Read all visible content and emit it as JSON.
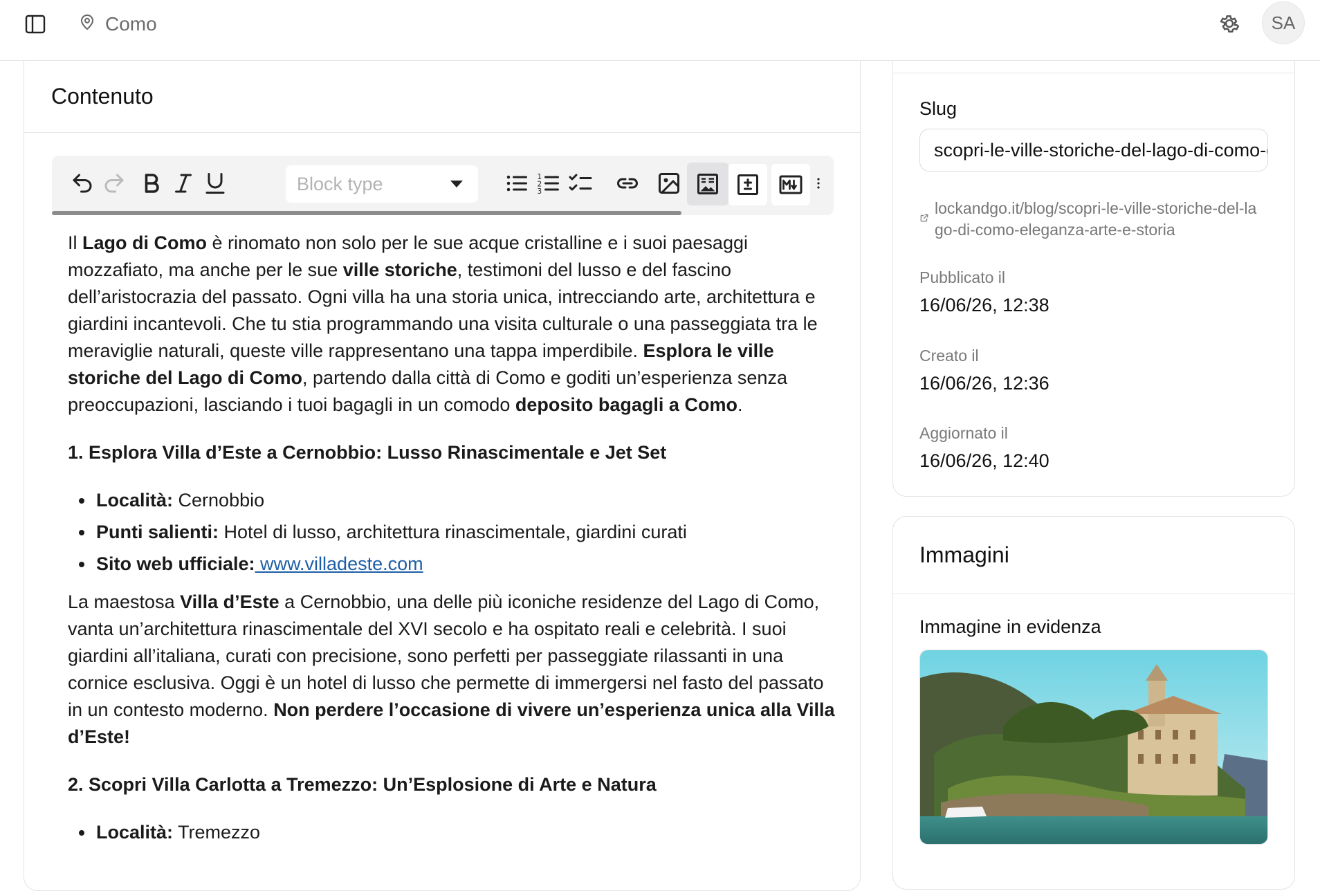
{
  "header": {
    "location": "Como",
    "avatar_initials": "SA"
  },
  "content": {
    "title": "Contenuto",
    "toolbar": {
      "block_type_placeholder": "Block type"
    },
    "intro": {
      "t1": "Il ",
      "b1": "Lago di Como",
      "t2": " è rinomato non solo per le sue acque cristalline e i suoi paesaggi mozzafiato, ma anche per le sue ",
      "b2": "ville storiche",
      "t3": ", testimoni del lusso e del fascino dell’aristocrazia del passato. Ogni villa ha una storia unica, intrecciando arte, architettura e giardini incantevoli. Che tu stia programmando una visita culturale o una passeggiata tra le meraviglie naturali, queste ville rappresentano una tappa imperdibile. ",
      "b3": "Esplora le ville storiche del Lago di Como",
      "t4": ", partendo dalla città di Como e goditi un’esperienza senza preoccupazioni, lasciando i tuoi bagagli in un comodo ",
      "b4": "deposito bagagli a Como",
      "t5": "."
    },
    "section1": {
      "heading": "1. Esplora Villa d’Este a Cernobbio: Lusso Rinascimentale e Jet Set",
      "items": [
        {
          "label": "Località:",
          "value": " Cernobbio"
        },
        {
          "label": "Punti salienti:",
          "value": " Hotel di lusso, architettura rinascimentale, giardini curati"
        },
        {
          "label": "Sito web ufficiale:",
          "link": " www.villadeste.com"
        }
      ],
      "para": {
        "t1": "La maestosa ",
        "b1": "Villa d’Este",
        "t2": " a Cernobbio, una delle più iconiche residenze del Lago di Como, vanta un’architettura rinascimentale del XVI secolo e ha ospitato reali e celebrità. I suoi giardini all’italiana, curati con precisione, sono perfetti per passeggiate rilassanti in una cornice esclusiva. Oggi è un hotel di lusso che permette di immergersi nel fasto del passato in un contesto moderno. ",
        "b2": "Non perdere l’occasione di vivere un’esperienza unica alla Villa d’Este!"
      }
    },
    "section2": {
      "heading": "2. Scopri Villa Carlotta a Tremezzo: Un’Esplosione di Arte e Natura",
      "items": [
        {
          "label": "Località:",
          "value": " Tremezzo"
        }
      ]
    }
  },
  "meta": {
    "slug_label": "Slug",
    "slug_value": "scopri-le-ville-storiche-del-lago-di-como-eleganza-arte-e-storia",
    "url": "lockandgo.it/blog/scopri-le-ville-storiche-del-lago-di-como-eleganza-arte-e-storia",
    "published_label": "Pubblicato il",
    "published_value": "16/06/26, 12:38",
    "created_label": "Creato il",
    "created_value": "16/06/26, 12:36",
    "updated_label": "Aggiornato il",
    "updated_value": "16/06/26, 12:40"
  },
  "images": {
    "title": "Immagini",
    "featured_label": "Immagine in evidenza"
  },
  "icons": {
    "sidebar": "sidebar-toggle-icon",
    "location": "map-pin-icon",
    "settings": "gear-icon"
  }
}
